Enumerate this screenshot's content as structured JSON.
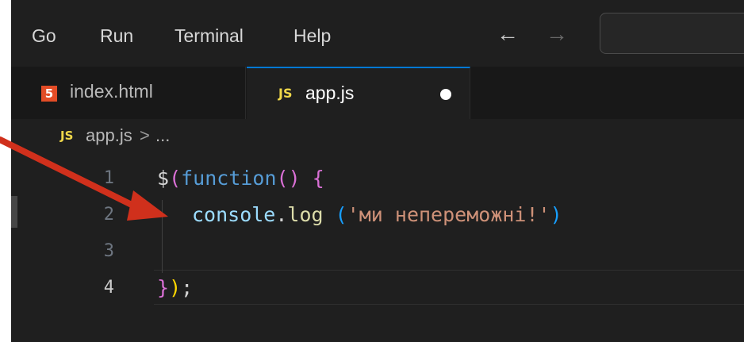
{
  "menu": {
    "items": [
      "Go",
      "Run",
      "Terminal",
      "Help"
    ]
  },
  "nav": {
    "back_icon": "arrow-left-icon",
    "forward_icon": "arrow-right-icon"
  },
  "tabs": [
    {
      "label": "index.html",
      "icon": "html5-icon",
      "icon_glyph": "5"
    },
    {
      "label": "app.js",
      "icon": "js-icon",
      "icon_glyph": "JS"
    }
  ],
  "breadcrumb": {
    "icon_glyph": "JS",
    "file": "app.js",
    "separator": ">",
    "ellipsis": "..."
  },
  "editor": {
    "lines": [
      {
        "number": "1",
        "parts": [
          "$",
          "(",
          "function",
          "()",
          " ",
          "{"
        ]
      },
      {
        "number": "2",
        "parts": [
          "console",
          ".",
          "log",
          " ",
          "(",
          "'ми непереможні!'",
          ")"
        ]
      },
      {
        "number": "3",
        "parts": []
      },
      {
        "number": "4",
        "parts": [
          "}",
          ")",
          ";"
        ]
      }
    ]
  },
  "colors": {
    "background": "#1f1f1f",
    "accent": "#0078d4",
    "keyword": "#569cd6",
    "string": "#ce9178",
    "bracket_gold": "#ffd700",
    "bracket_pink": "#da70d6",
    "annotation_arrow": "#d0301c"
  }
}
